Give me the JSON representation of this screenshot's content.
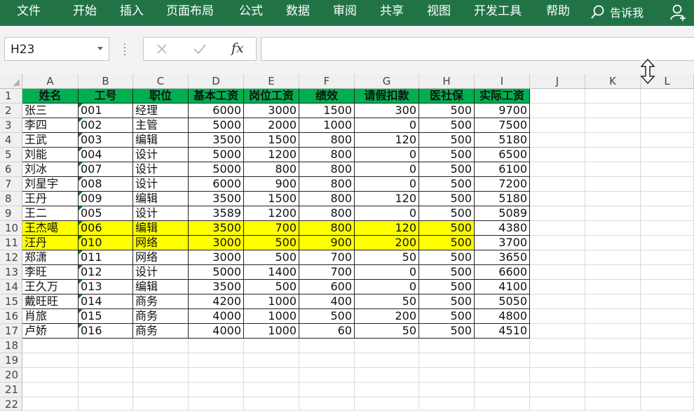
{
  "ribbon": {
    "tabs": [
      "文件",
      "开始",
      "插入",
      "页面布局",
      "公式",
      "数据",
      "审阅",
      "共享",
      "视图",
      "开发工具",
      "帮助"
    ],
    "tell_me": "告诉我"
  },
  "formula_bar": {
    "name_box": "H23",
    "cancel_icon": "×",
    "enter_icon": "✓",
    "fx_label": "fx",
    "formula": ""
  },
  "sheet": {
    "columns": [
      "A",
      "B",
      "C",
      "D",
      "E",
      "F",
      "G",
      "H",
      "I",
      "J",
      "K",
      "L"
    ],
    "row_numbers": [
      "1",
      "2",
      "3",
      "4",
      "5",
      "6",
      "7",
      "8",
      "9",
      "10",
      "11",
      "12",
      "13",
      "14",
      "15",
      "16",
      "17",
      "18",
      "19",
      "20",
      "21",
      "22"
    ],
    "header": [
      "姓名",
      "工号",
      "职位",
      "基本工资",
      "岗位工资",
      "绩效",
      "请假扣款",
      "医社保",
      "实际工资"
    ],
    "highlighted_rows": [
      8,
      9
    ],
    "rows": [
      [
        "张三",
        "001",
        "经理",
        "6000",
        "3000",
        "1500",
        "300",
        "500",
        "9700"
      ],
      [
        "李四",
        "002",
        "主管",
        "5000",
        "2000",
        "1000",
        "0",
        "500",
        "7500"
      ],
      [
        "王武",
        "003",
        "编辑",
        "3500",
        "1500",
        "800",
        "120",
        "500",
        "5180"
      ],
      [
        "刘能",
        "004",
        "设计",
        "5000",
        "1200",
        "800",
        "0",
        "500",
        "6500"
      ],
      [
        "刘冰",
        "007",
        "设计",
        "5000",
        "800",
        "800",
        "0",
        "500",
        "6100"
      ],
      [
        "刘星宇",
        "008",
        "设计",
        "6000",
        "900",
        "800",
        "0",
        "500",
        "7200"
      ],
      [
        "王丹",
        "009",
        "编辑",
        "3500",
        "1500",
        "800",
        "120",
        "500",
        "5180"
      ],
      [
        "王二",
        "005",
        "设计",
        "3589",
        "1200",
        "800",
        "0",
        "500",
        "5089"
      ],
      [
        "王杰噶",
        "006",
        "编辑",
        "3500",
        "700",
        "800",
        "120",
        "500",
        "4380"
      ],
      [
        "汪丹",
        "010",
        "网络",
        "3000",
        "500",
        "900",
        "200",
        "500",
        "3700"
      ],
      [
        "郑潇",
        "011",
        "网络",
        "3000",
        "500",
        "700",
        "50",
        "500",
        "3650"
      ],
      [
        "李旺",
        "012",
        "设计",
        "5000",
        "1400",
        "700",
        "0",
        "500",
        "6600"
      ],
      [
        "王久万",
        "013",
        "编辑",
        "3500",
        "500",
        "600",
        "0",
        "500",
        "4100"
      ],
      [
        "戴旺旺",
        "014",
        "商务",
        "4200",
        "1000",
        "400",
        "50",
        "500",
        "5050"
      ],
      [
        "肖旅",
        "015",
        "商务",
        "4000",
        "1000",
        "500",
        "200",
        "500",
        "4800"
      ],
      [
        "卢娇",
        "016",
        "商务",
        "4000",
        "1000",
        "60",
        "50",
        "500",
        "4510"
      ]
    ]
  },
  "colors": {
    "ribbon": "#217346",
    "header_fill": "#00b050",
    "highlight_fill": "#ffff00"
  }
}
